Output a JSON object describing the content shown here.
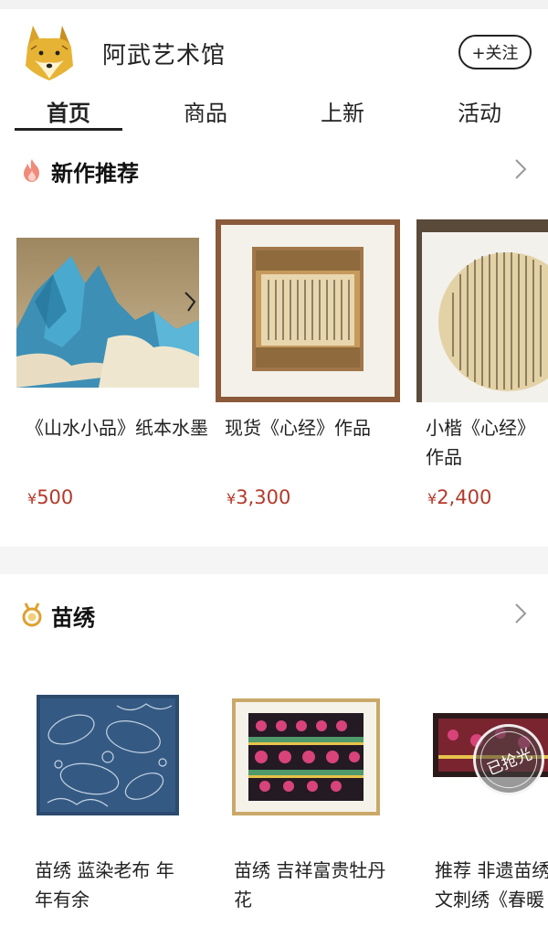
{
  "shop": {
    "name": "阿武艺术馆",
    "follow_label": "+关注"
  },
  "tabs": [
    {
      "label": "首页",
      "active": true
    },
    {
      "label": "商品",
      "active": false
    },
    {
      "label": "上新",
      "active": false
    },
    {
      "label": "活动",
      "active": false
    }
  ],
  "sections": [
    {
      "title": "新作推荐",
      "icon": "flame-icon",
      "products": [
        {
          "title": "《山水小品》纸本水墨",
          "price": "500",
          "currency": "¥"
        },
        {
          "title": "现货《心经》作品",
          "price": "3,300",
          "currency": "¥"
        },
        {
          "title": "小楷《心经》作品",
          "price": "2,400",
          "currency": "¥"
        }
      ]
    },
    {
      "title": "苗绣",
      "icon": "medal-icon",
      "products": [
        {
          "title": "苗绣 蓝染老布 年年有余",
          "sold_out": false
        },
        {
          "title": "苗绣  吉祥富贵牡丹花",
          "sold_out": false
        },
        {
          "title": "推荐 非遗苗绣 文刺绣《春暖",
          "sold_out": true,
          "sold_label": "已抢光"
        }
      ]
    }
  ],
  "colors": {
    "price": "#b33a2a",
    "flame": "#f08a7a",
    "medal": "#e0a030",
    "divider_band": "#f5f5f5"
  }
}
